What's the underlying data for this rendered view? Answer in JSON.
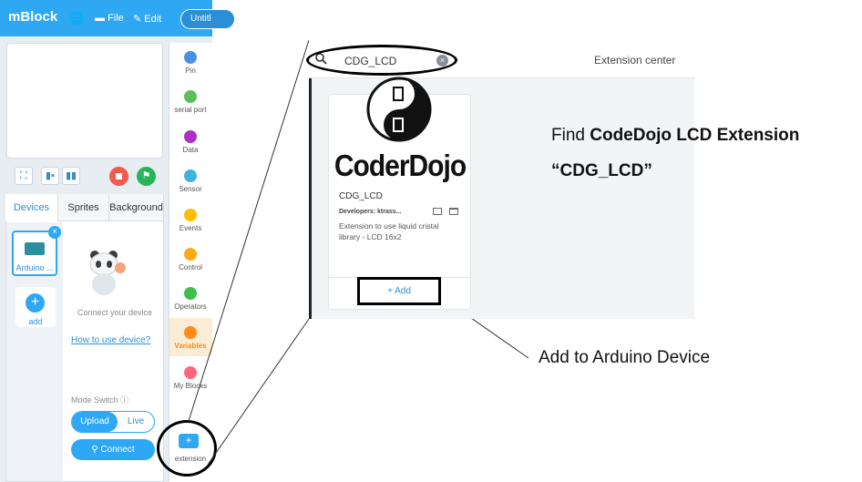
{
  "mblock": {
    "app_name": "mBlock",
    "menu": {
      "file": "File",
      "edit": "Edit"
    },
    "project_title": "Untitl",
    "tabs": [
      "Devices",
      "Sprites",
      "Background"
    ],
    "device": {
      "name": "Arduino ...",
      "add_label": "add"
    },
    "connect_hint": "Connect your device",
    "how_to_link": "How to use device?",
    "mode_switch_label": "Mode Switch",
    "mode_options": [
      "Upload",
      "Live"
    ],
    "connect_button": "Connect",
    "categories": [
      {
        "label": "Pin",
        "color": "#4a90e2"
      },
      {
        "label": "serial port",
        "color": "#59c059"
      },
      {
        "label": "Data",
        "color": "#b02fc7"
      },
      {
        "label": "Sensor",
        "color": "#3fb4e0"
      },
      {
        "label": "Events",
        "color": "#ffbf00"
      },
      {
        "label": "Control",
        "color": "#ffab19"
      },
      {
        "label": "Operators",
        "color": "#40bf4a"
      },
      {
        "label": "Variables",
        "color": "#ff8c1a"
      },
      {
        "label": "My Blocks",
        "color": "#ff6680"
      }
    ],
    "extension_label": "extension"
  },
  "extension_center": {
    "search_value": "CDG_LCD",
    "title": "Extension center",
    "card": {
      "logo_text": "CoderDojo",
      "name": "CDG_LCD",
      "developers": "Developers: ktrass...",
      "description": "Extension to use liquid cristal library - LCD 16x2",
      "add_button": "+ Add"
    }
  },
  "annotations": {
    "find_prefix": "Find ",
    "find_bold": "CodeDojo LCD Extension",
    "find_quote": "“CDG_LCD”",
    "add_note": "Add to Arduino Device"
  },
  "colors": {
    "accent": "#2ea8f2",
    "stop": "#f05b4b",
    "go": "#27b55a"
  }
}
